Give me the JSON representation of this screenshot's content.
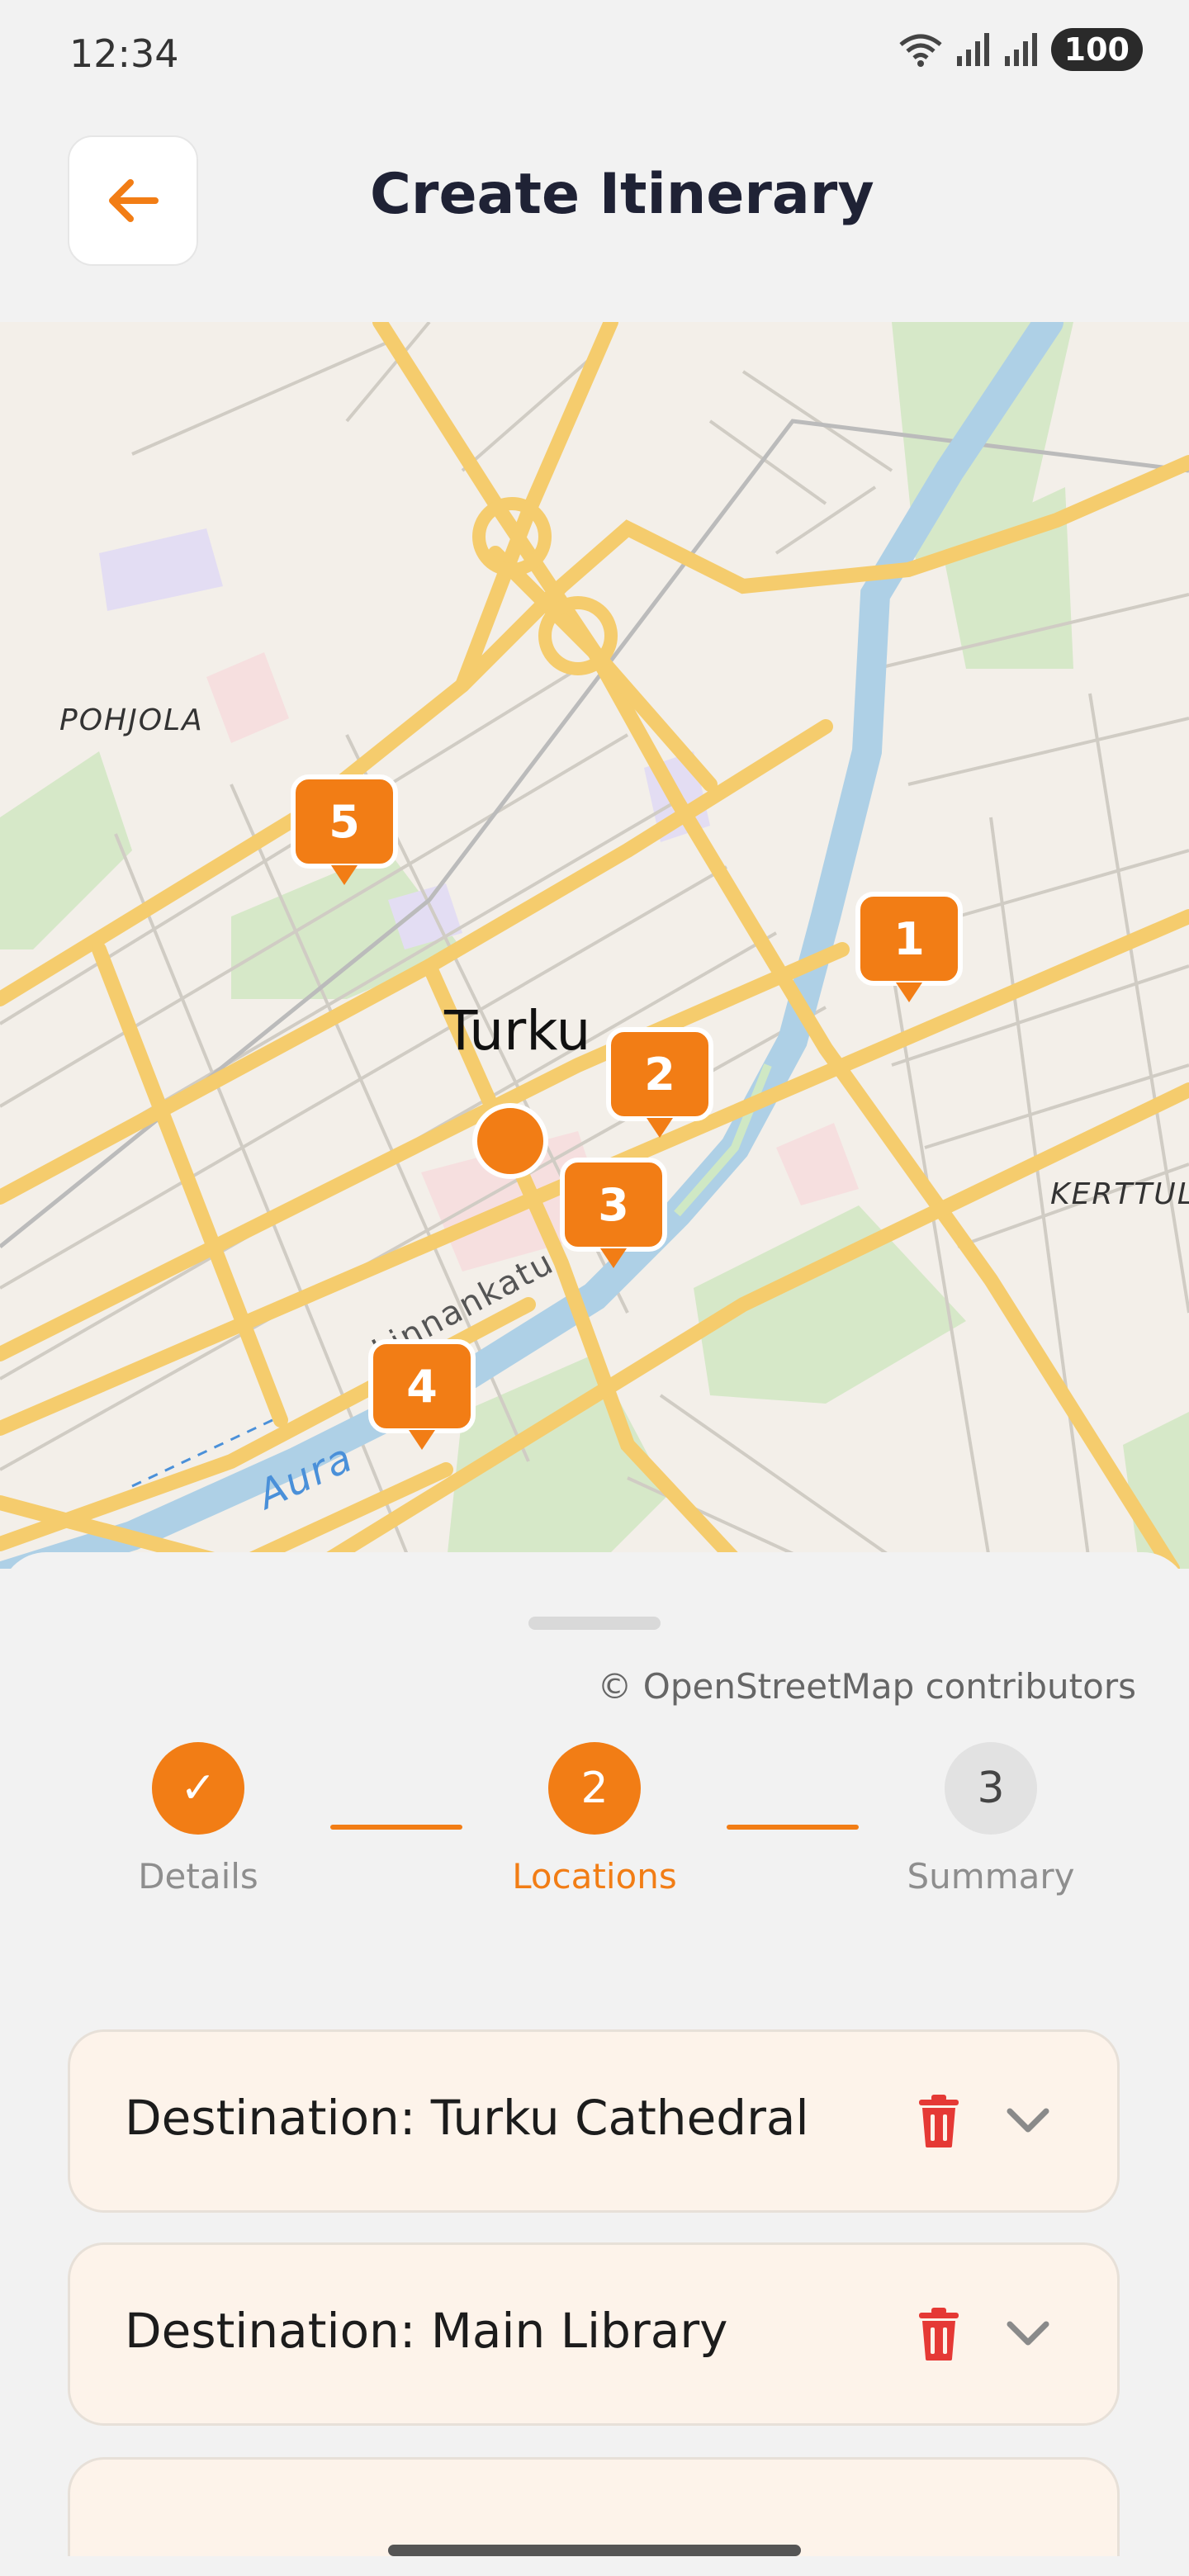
{
  "status_bar": {
    "time": "12:34",
    "battery": "100"
  },
  "header": {
    "title": "Create Itinerary",
    "back_icon": "arrow-left-icon"
  },
  "map": {
    "city_label": "Turku",
    "district_labels": [
      "POHJOLA",
      "KERTTUL"
    ],
    "street_labels": [
      "Linnankatu",
      "Aura"
    ],
    "markers": [
      "1",
      "2",
      "3",
      "4",
      "5"
    ],
    "attribution": "© OpenStreetMap contributors"
  },
  "stepper": {
    "steps": [
      {
        "label": "Details",
        "number": "✓",
        "state": "done"
      },
      {
        "label": "Locations",
        "number": "2",
        "state": "active"
      },
      {
        "label": "Summary",
        "number": "3",
        "state": "pending"
      }
    ]
  },
  "destinations": [
    {
      "label": "Destination: Turku Cathedral"
    },
    {
      "label": "Destination: Main Library"
    }
  ],
  "colors": {
    "accent": "#f27d15",
    "card_bg": "#fdf3ea",
    "delete": "#e53935"
  }
}
